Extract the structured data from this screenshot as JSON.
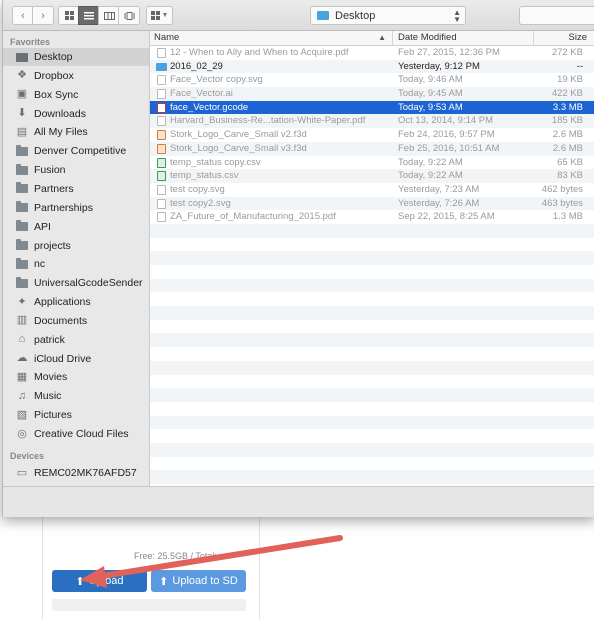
{
  "toolbar": {
    "location": "Desktop"
  },
  "sidebar": {
    "favorites_heading": "Favorites",
    "devices_heading": "Devices",
    "favorites": [
      {
        "label": "Desktop",
        "icon": "desktop-icon",
        "selected": true
      },
      {
        "label": "Dropbox",
        "icon": "dropbox-icon"
      },
      {
        "label": "Box Sync",
        "icon": "box-icon"
      },
      {
        "label": "Downloads",
        "icon": "downloads-icon"
      },
      {
        "label": "All My Files",
        "icon": "all-files-icon"
      },
      {
        "label": "Denver Competitive",
        "icon": "folder-icon"
      },
      {
        "label": "Fusion",
        "icon": "folder-icon"
      },
      {
        "label": "Partners",
        "icon": "folder-icon"
      },
      {
        "label": "Partnerships",
        "icon": "folder-icon"
      },
      {
        "label": "API",
        "icon": "folder-icon"
      },
      {
        "label": "projects",
        "icon": "folder-icon"
      },
      {
        "label": "nc",
        "icon": "folder-icon"
      },
      {
        "label": "UniversalGcodeSender",
        "icon": "folder-icon"
      },
      {
        "label": "Applications",
        "icon": "applications-icon"
      },
      {
        "label": "Documents",
        "icon": "documents-icon"
      },
      {
        "label": "patrick",
        "icon": "home-icon"
      },
      {
        "label": "iCloud Drive",
        "icon": "cloud-icon"
      },
      {
        "label": "Movies",
        "icon": "movies-icon"
      },
      {
        "label": "Music",
        "icon": "music-icon"
      },
      {
        "label": "Pictures",
        "icon": "pictures-icon"
      },
      {
        "label": "Creative Cloud Files",
        "icon": "creative-cloud-icon"
      }
    ],
    "devices": [
      {
        "label": "REMC02MK76AFD57",
        "icon": "computer-icon"
      }
    ]
  },
  "file_list": {
    "columns": {
      "name": "Name",
      "date": "Date Modified",
      "size": "Size"
    },
    "rows": [
      {
        "name": "12 - When to Ally and When to Acquire.pdf",
        "date": "Feb 27, 2015, 12:36 PM",
        "size": "272 KB",
        "kind": "doc",
        "dim": true
      },
      {
        "name": "2016_02_29",
        "date": "Yesterday, 9:12 PM",
        "size": "--",
        "kind": "folder",
        "dim": false
      },
      {
        "name": "Face_Vector copy.svg",
        "date": "Today, 9:46 AM",
        "size": "19 KB",
        "kind": "doc",
        "dim": true
      },
      {
        "name": "Face_Vector.ai",
        "date": "Today, 9:45 AM",
        "size": "422 KB",
        "kind": "doc",
        "dim": true
      },
      {
        "name": "face_Vector.gcode",
        "date": "Today, 9:53 AM",
        "size": "3.3 MB",
        "kind": "red",
        "dim": false,
        "selected": true
      },
      {
        "name": "Harvard_Business-Re...tation-White-Paper.pdf",
        "date": "Oct 13, 2014, 9:14 PM",
        "size": "185 KB",
        "kind": "doc",
        "dim": true
      },
      {
        "name": "Stork_Logo_Carve_Small v2.f3d",
        "date": "Feb 24, 2016, 9:57 PM",
        "size": "2.6 MB",
        "kind": "orange",
        "dim": true
      },
      {
        "name": "Stork_Logo_Carve_Small v3.f3d",
        "date": "Feb 25, 2016, 10:51 AM",
        "size": "2.6 MB",
        "kind": "orange",
        "dim": true
      },
      {
        "name": "temp_status copy.csv",
        "date": "Today, 9:22 AM",
        "size": "65 KB",
        "kind": "green",
        "dim": true
      },
      {
        "name": "temp_status.csv",
        "date": "Today, 9:22 AM",
        "size": "83 KB",
        "kind": "green",
        "dim": true
      },
      {
        "name": "test copy.svg",
        "date": "Yesterday, 7:23 AM",
        "size": "462 bytes",
        "kind": "doc",
        "dim": true
      },
      {
        "name": "test copy2.svg",
        "date": "Yesterday, 7:26 AM",
        "size": "463 bytes",
        "kind": "doc",
        "dim": true
      },
      {
        "name": "ZA_Future_of_Manufacturing_2015.pdf",
        "date": "Sep 22, 2015, 8:25 AM",
        "size": "1.3 MB",
        "kind": "doc",
        "dim": true
      }
    ]
  },
  "background_page": {
    "free_text": "Free: 25.5GB / Total:",
    "upload_label": "Upload",
    "upload_sd_label": "Upload to SD"
  },
  "colors": {
    "selection": "#1c64d3",
    "upload_button": "#2b6fc0",
    "upload_sd_button": "#5b9ae0",
    "annotation_arrow": "#e0625a"
  }
}
